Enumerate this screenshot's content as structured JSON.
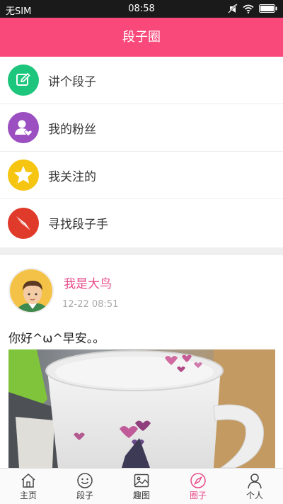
{
  "status_bar": {
    "carrier": "无SIM",
    "time": "08:58"
  },
  "header": {
    "title": "段子圈"
  },
  "menu": {
    "items": [
      {
        "label": "讲个段子",
        "icon": "edit-icon",
        "color": "#1dc67c"
      },
      {
        "label": "我的粉丝",
        "icon": "fans-icon",
        "color": "#9b4fc0"
      },
      {
        "label": "我关注的",
        "icon": "star-icon",
        "color": "#f5c511"
      },
      {
        "label": "寻找段子手",
        "icon": "compass-icon",
        "color": "#e03a2a"
      }
    ]
  },
  "post": {
    "username": "我是大鸟",
    "time": "12-22 08:51",
    "text": "你好^ω^早安。。"
  },
  "tabbar": {
    "tabs": [
      {
        "label": "主页",
        "icon": "home-icon"
      },
      {
        "label": "段子",
        "icon": "smile-icon"
      },
      {
        "label": "趣图",
        "icon": "picture-icon"
      },
      {
        "label": "圈子",
        "icon": "compass-icon",
        "active": true
      },
      {
        "label": "个人",
        "icon": "user-icon"
      }
    ]
  },
  "colors": {
    "header": "#f8497a",
    "accent": "#e94b8a"
  }
}
